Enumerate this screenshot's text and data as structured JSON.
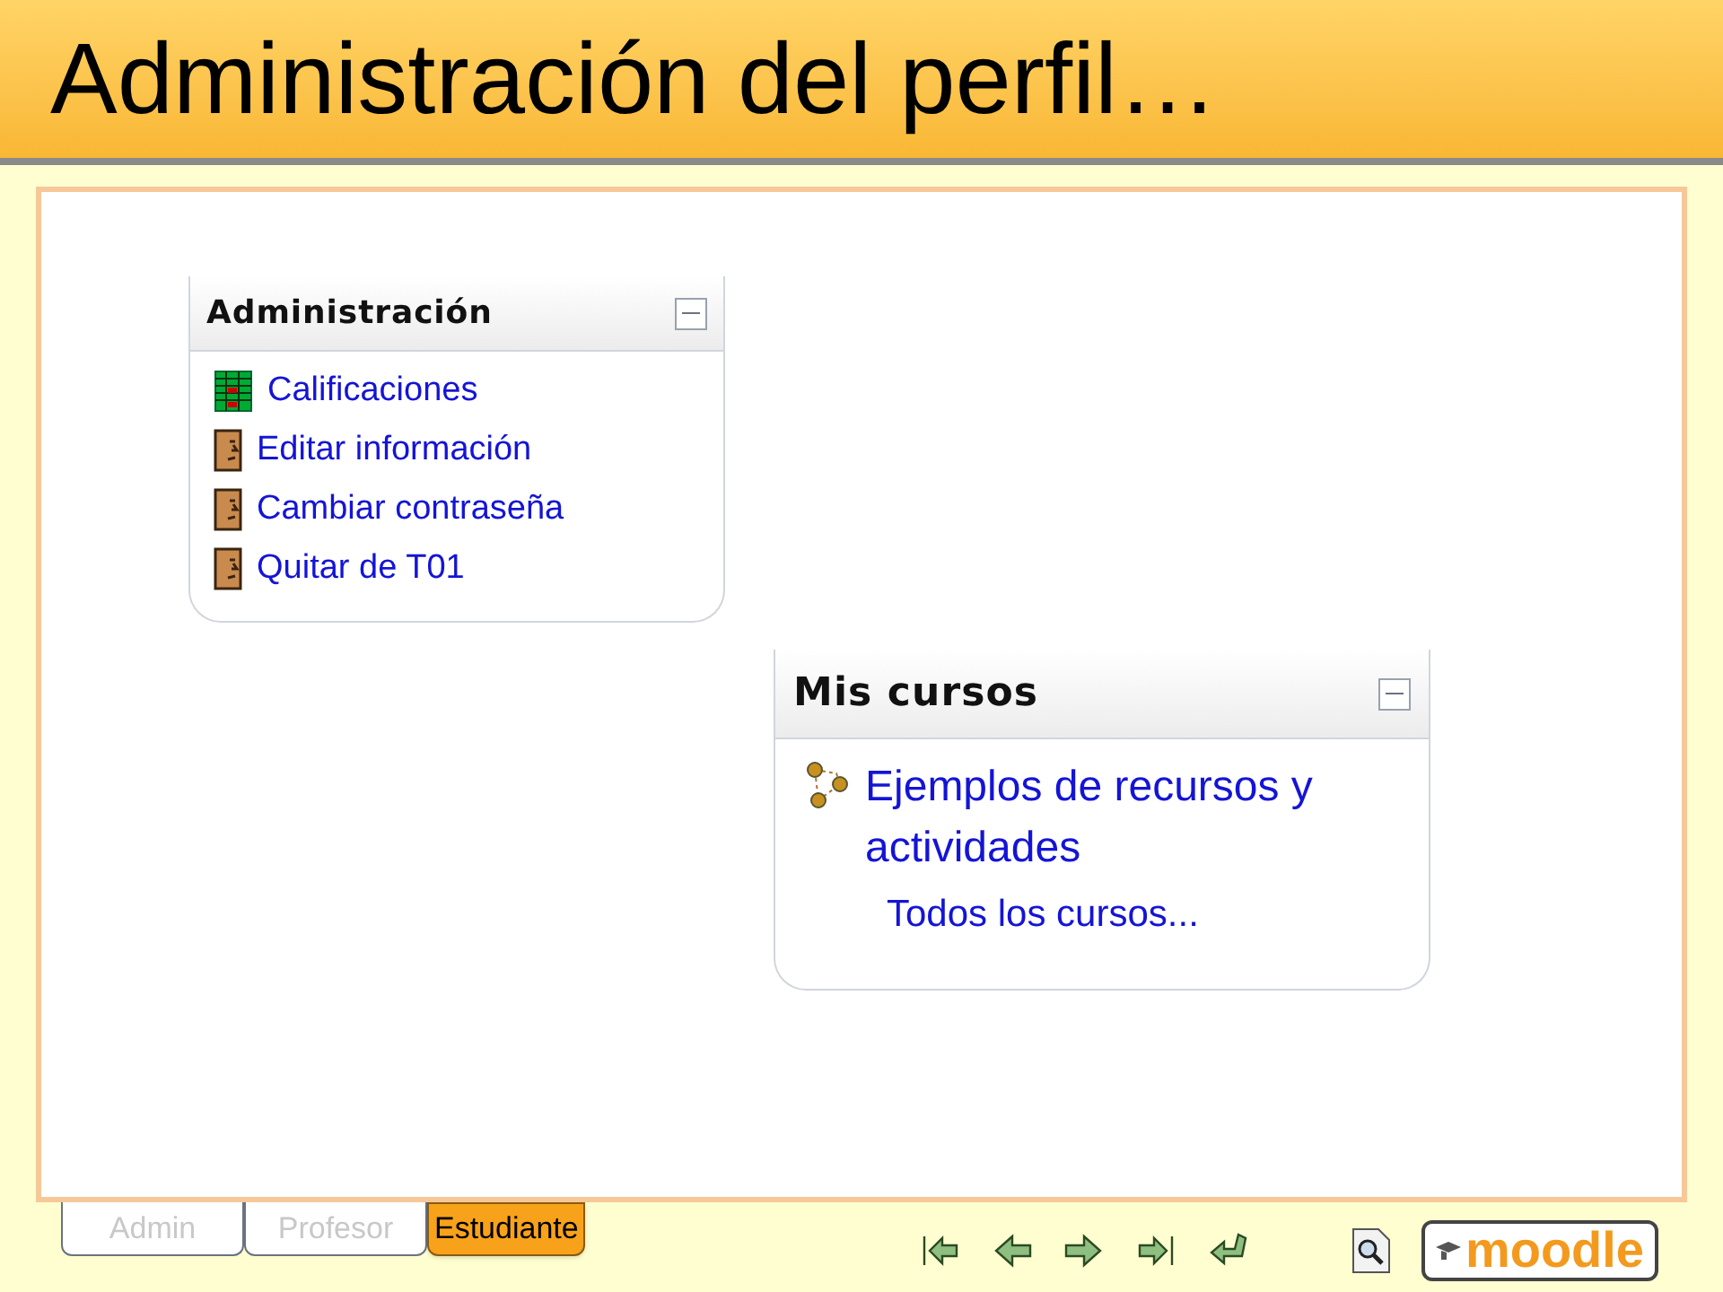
{
  "slide": {
    "title": "Administración del perfil…"
  },
  "admin_block": {
    "title": "Administración",
    "items": [
      {
        "label": "Calificaciones",
        "kind": "grades"
      },
      {
        "label": "Editar información",
        "kind": "user"
      },
      {
        "label": "Cambiar contraseña",
        "kind": "user"
      },
      {
        "label": "Quitar de T01",
        "kind": "user"
      }
    ]
  },
  "courses_block": {
    "title": "Mis cursos",
    "courses": [
      {
        "label": "Ejemplos de recursos y actividades",
        "kind": "course"
      }
    ],
    "all_link": "Todos los cursos..."
  },
  "role_tabs": [
    {
      "label": "Admin",
      "selected": false
    },
    {
      "label": "Profesor",
      "selected": false
    },
    {
      "label": "Estudiante",
      "selected": true
    }
  ],
  "logo": {
    "text": "moodle"
  }
}
